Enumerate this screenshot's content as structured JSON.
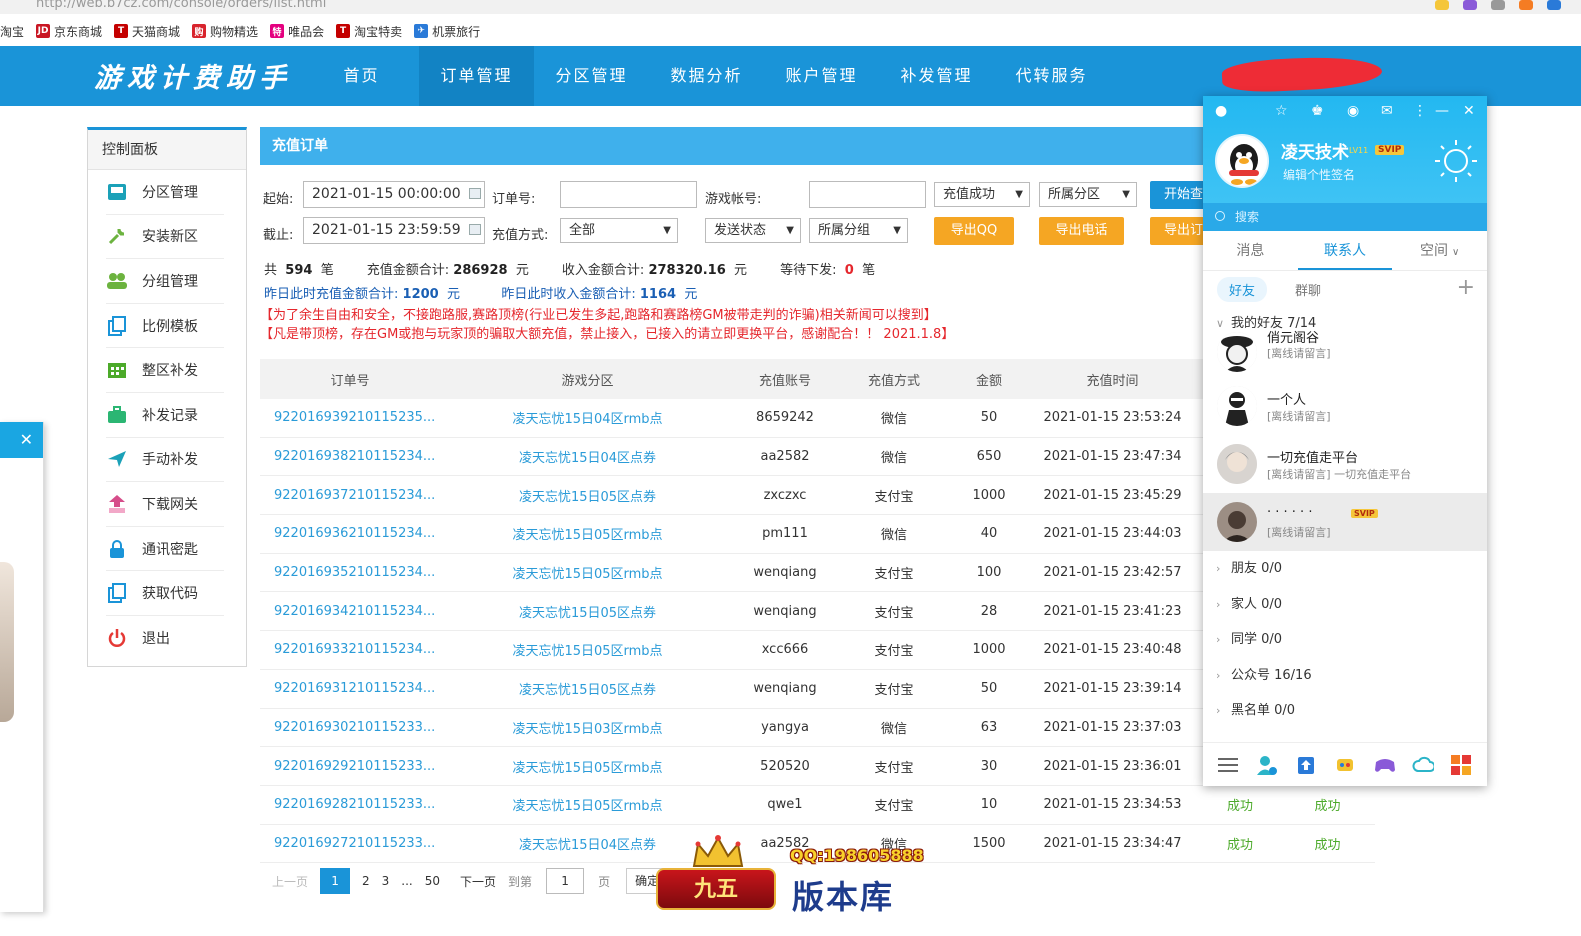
{
  "browser": {
    "url": "http://web.b7cz.com/console/orders/list.html",
    "bookmarks": [
      {
        "label": "淘宝",
        "icon": "taobao-icon",
        "color": "#ff5000",
        "glyph": ""
      },
      {
        "label": "京东商城",
        "icon": "jd-icon",
        "color": "#c91623",
        "glyph": "JD"
      },
      {
        "label": "天猫商城",
        "icon": "tmall-icon",
        "color": "#c40000",
        "glyph": "T"
      },
      {
        "label": "购物精选",
        "icon": "shopping-icon",
        "color": "#d8242d",
        "glyph": "购"
      },
      {
        "label": "唯品会",
        "icon": "vip-icon",
        "color": "#e4007f",
        "glyph": "特"
      },
      {
        "label": "淘宝特卖",
        "icon": "taobao-sale-icon",
        "color": "#c40000",
        "glyph": "T"
      },
      {
        "label": "机票旅行",
        "icon": "travel-icon",
        "color": "#2a7ad8",
        "glyph": "✈"
      }
    ]
  },
  "nav": {
    "logo": "游戏计费助手",
    "items": [
      "首页",
      "订单管理",
      "分区管理",
      "数据分析",
      "账户管理",
      "补发管理",
      "代转服务"
    ],
    "active_index": 1,
    "brand_color": "#1a94d8"
  },
  "sidebar": {
    "title": "控制面板",
    "items": [
      {
        "label": "分区管理",
        "icon": "inbox-icon",
        "color": "#1ba1b8"
      },
      {
        "label": "安装新区",
        "icon": "wrench-icon",
        "color": "#6cb33f"
      },
      {
        "label": "分组管理",
        "icon": "users-icon",
        "color": "#6cb33f"
      },
      {
        "label": "比例模板",
        "icon": "copy-icon",
        "color": "#1a94d8"
      },
      {
        "label": "整区补发",
        "icon": "calendar-icon",
        "color": "#4caa2a"
      },
      {
        "label": "补发记录",
        "icon": "briefcase-icon",
        "color": "#2bb673"
      },
      {
        "label": "手动补发",
        "icon": "send-icon",
        "color": "#1ba1b8"
      },
      {
        "label": "下载网关",
        "icon": "download-icon",
        "color": "#d64d8a"
      },
      {
        "label": "通讯密匙",
        "icon": "lock-icon",
        "color": "#1a94d8"
      },
      {
        "label": "获取代码",
        "icon": "code-copy-icon",
        "color": "#1a94d8"
      },
      {
        "label": "退出",
        "icon": "power-icon",
        "color": "#e53935"
      }
    ]
  },
  "panel": {
    "title": "充值订单",
    "filters": {
      "start_label": "起始:",
      "start_value": "2021-01-15 00:00:00",
      "end_label": "截止:",
      "end_value": "2021-01-15 23:59:59",
      "order_label": "订单号:",
      "order_value": "",
      "account_label": "游戏帐号:",
      "account_value": "",
      "method_label": "充值方式:",
      "method_value": "全部",
      "status_value": "充值成功",
      "zone_value": "所属分区",
      "send_value": "发送状态",
      "group_value": "所属分组",
      "search_btn": "开始查询",
      "export_qq": "导出QQ",
      "export_phone": "导出电话",
      "export_order": "导出订单"
    },
    "stats": {
      "total_prefix": "共",
      "total_count": "594",
      "total_unit": "笔",
      "charge_label": "充值金额合计:",
      "charge_value": "286928",
      "income_label": "收入金额合计:",
      "income_value": "278320.16",
      "yuan": "元",
      "pending_label": "等待下发:",
      "pending_value": "0",
      "pending_unit": "笔",
      "yesterday_charge_label": "昨日此时充值金额合计:",
      "yesterday_charge_value": "1200",
      "yesterday_income_label": "昨日此时收入金额合计:",
      "yesterday_income_value": "1164"
    },
    "warnings": [
      "【为了余生自由和安全，不接跑路服,赛路顶榜(行业已发生多起,跑路和赛路榜GM被带走判的诈骗)相关新闻可以搜到】",
      "【凡是带顶榜，存在GM或抱与玩家顶的骗取大额充值，禁止接入，已接入的请立即更换平台，感谢配合！！ 2021.1.8】"
    ],
    "columns": [
      "订单号",
      "游戏分区",
      "充值账号",
      "充值方式",
      "金额",
      "充值时间",
      "",
      ""
    ],
    "rows": [
      {
        "order": "922016939210115235...",
        "zone": "凌天忘忧15日04区rmb点",
        "account": "8659242",
        "method": "微信",
        "amount": "50",
        "time": "2021-01-15 23:53:24",
        "s1": "",
        "s2": ""
      },
      {
        "order": "922016938210115234...",
        "zone": "凌天忘忧15日04区点券",
        "account": "aa2582",
        "method": "微信",
        "amount": "650",
        "time": "2021-01-15 23:47:34",
        "s1": "",
        "s2": ""
      },
      {
        "order": "922016937210115234...",
        "zone": "凌天忘忧15日05区点券",
        "account": "zxczxc",
        "method": "支付宝",
        "amount": "1000",
        "time": "2021-01-15 23:45:29",
        "s1": "",
        "s2": ""
      },
      {
        "order": "922016936210115234...",
        "zone": "凌天忘忧15日05区rmb点",
        "account": "pm111",
        "method": "微信",
        "amount": "40",
        "time": "2021-01-15 23:44:03",
        "s1": "",
        "s2": ""
      },
      {
        "order": "922016935210115234...",
        "zone": "凌天忘忧15日05区rmb点",
        "account": "wenqiang",
        "method": "支付宝",
        "amount": "100",
        "time": "2021-01-15 23:42:57",
        "s1": "",
        "s2": ""
      },
      {
        "order": "922016934210115234...",
        "zone": "凌天忘忧15日05区点券",
        "account": "wenqiang",
        "method": "支付宝",
        "amount": "28",
        "time": "2021-01-15 23:41:23",
        "s1": "",
        "s2": ""
      },
      {
        "order": "922016933210115234...",
        "zone": "凌天忘忧15日05区rmb点",
        "account": "xcc666",
        "method": "支付宝",
        "amount": "1000",
        "time": "2021-01-15 23:40:48",
        "s1": "",
        "s2": ""
      },
      {
        "order": "922016931210115234...",
        "zone": "凌天忘忧15日05区点券",
        "account": "wenqiang",
        "method": "支付宝",
        "amount": "50",
        "time": "2021-01-15 23:39:14",
        "s1": "",
        "s2": ""
      },
      {
        "order": "922016930210115233...",
        "zone": "凌天忘忧15日03区rmb点",
        "account": "yangya",
        "method": "微信",
        "amount": "63",
        "time": "2021-01-15 23:37:03",
        "s1": "",
        "s2": ""
      },
      {
        "order": "922016929210115233...",
        "zone": "凌天忘忧15日05区rmb点",
        "account": "520520",
        "method": "支付宝",
        "amount": "30",
        "time": "2021-01-15 23:36:01",
        "s1": "",
        "s2": ""
      },
      {
        "order": "922016928210115233...",
        "zone": "凌天忘忧15日05区rmb点",
        "account": "qwe1",
        "method": "支付宝",
        "amount": "10",
        "time": "2021-01-15 23:34:53",
        "s1": "成功",
        "s2": "成功"
      },
      {
        "order": "922016927210115233...",
        "zone": "凌天忘忧15日04区点券",
        "account": "aa2582",
        "method": "微信",
        "amount": "1500",
        "time": "2021-01-15 23:34:47",
        "s1": "成功",
        "s2": "成功"
      }
    ],
    "pager": {
      "prev": "上一页",
      "pages": [
        "1",
        "2",
        "3",
        "...",
        "50"
      ],
      "current": "1",
      "next": "下一页",
      "goto": "到第",
      "goto_value": "1",
      "page_unit": "页",
      "confirm": "确定"
    }
  },
  "watermark": {
    "qq": "QQ:198605888",
    "badge": "九五",
    "text": "版本库"
  },
  "qq_window": {
    "name": "凌天技术",
    "level": "LV11",
    "svip": "SVIP",
    "signature": "编辑个性签名",
    "search_placeholder": "搜索",
    "tabs": [
      "消息",
      "联系人",
      "空间"
    ],
    "active_tab": 1,
    "sub_tabs": [
      "好友",
      "群聊"
    ],
    "my_group": "我的好友 7/14",
    "friends": [
      {
        "name": "俏元阁谷",
        "status": "[离线请留言]",
        "sig": "",
        "svip": false
      },
      {
        "name": "一个人",
        "status": "[离线请留言]",
        "sig": "",
        "svip": false
      },
      {
        "name": "一切充值走平台",
        "status": "[离线请留言]",
        "sig": "一切充值走平台",
        "svip": false
      },
      {
        "name": "· · · · · ·",
        "status": "[离线请留言]",
        "sig": "",
        "svip": true
      }
    ],
    "groups": [
      "朋友 0/0",
      "家人 0/0",
      "同学 0/0",
      "公众号 16/16",
      "黑名单 0/0"
    ]
  }
}
